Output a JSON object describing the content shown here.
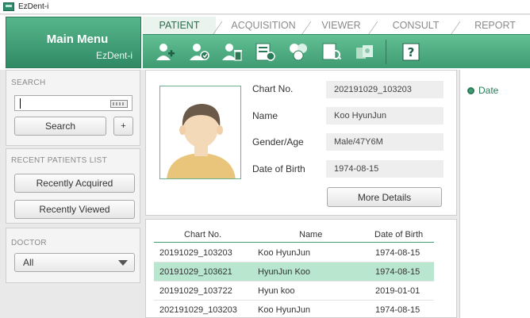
{
  "window": {
    "title": "EzDent-i"
  },
  "main_menu": {
    "title": "Main Menu",
    "subtitle": "EzDent-i"
  },
  "tabs": [
    {
      "label": "PATIENT",
      "active": true
    },
    {
      "label": "ACQUISITION",
      "active": false
    },
    {
      "label": "VIEWER",
      "active": false
    },
    {
      "label": "CONSULT",
      "active": false
    },
    {
      "label": "REPORT",
      "active": false
    }
  ],
  "toolbar_icons": [
    "add-patient-icon",
    "edit-patient-icon",
    "delete-patient-icon",
    "patient-chart-icon",
    "merge-patients-icon",
    "view-images-icon",
    "transfer-icon",
    "help-icon"
  ],
  "search": {
    "title": "SEARCH",
    "button_label": "Search",
    "plus_label": "+"
  },
  "recent": {
    "title": "RECENT PATIENTS LIST",
    "acquired_label": "Recently Acquired",
    "viewed_label": "Recently Viewed"
  },
  "doctor": {
    "title": "DOCTOR",
    "selected": "All"
  },
  "patient": {
    "labels": {
      "chart_no": "Chart No.",
      "name": "Name",
      "gender_age": "Gender/Age",
      "dob": "Date of Birth"
    },
    "values": {
      "chart_no": "202191029_103203",
      "name": "Koo HyunJun",
      "gender_age": "Male/47Y6M",
      "dob": "1974-08-15"
    },
    "more_details_label": "More Details"
  },
  "list": {
    "headers": {
      "chart_no": "Chart No.",
      "name": "Name",
      "dob": "Date of Birth"
    },
    "rows": [
      {
        "chart_no": "20191029_103203",
        "name": "Koo HyunJun",
        "dob": "1974-08-15",
        "selected": false
      },
      {
        "chart_no": "20191029_103621",
        "name": "HyunJun Koo",
        "dob": "1974-08-15",
        "selected": true
      },
      {
        "chart_no": "20191029_103722",
        "name": "Hyun koo",
        "dob": "2019-01-01",
        "selected": false
      },
      {
        "chart_no": "202191029_103203",
        "name": "Koo HyunJun",
        "dob": "1974-08-15",
        "selected": false
      }
    ]
  },
  "right_panel": {
    "option_label": "Date"
  },
  "colors": {
    "accent": "#3f9b72",
    "selection": "#b9e6cf",
    "tab_active": "#2a6b4c"
  }
}
